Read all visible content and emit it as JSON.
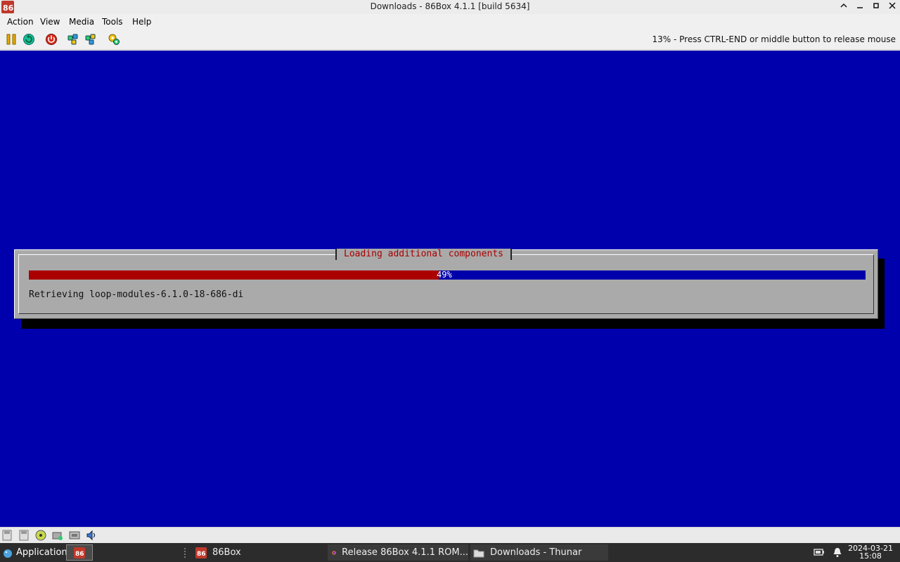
{
  "window": {
    "title": "Downloads - 86Box 4.1.1 [build 5634]",
    "controls": {
      "up": "⌃",
      "minimize": "_",
      "maximize": "▫",
      "close": "✕"
    }
  },
  "menu": [
    "Action",
    "View",
    "Media",
    "Tools",
    "Help"
  ],
  "toolbar": {
    "icons": [
      "pause-icon",
      "reset-icon",
      "power-icon",
      "ctrl-alt-del-icon",
      "ctrl-alt-esc-icon",
      "settings-icon"
    ],
    "status_text": "13% - Press CTRL-END or middle button to release mouse"
  },
  "screen": {
    "bg_color": "#0000ac",
    "dialog": {
      "title": "Loading additional components",
      "progress_percent": 49,
      "progress_label": "49%",
      "message": "Retrieving loop-modules-6.1.0-18-686-di"
    }
  },
  "statusbar": {
    "icons": [
      "floppy-drive-1-icon",
      "floppy-drive-2-icon",
      "cdrom-icon",
      "hard-disk-icon",
      "network-icon",
      "sound-icon"
    ]
  },
  "taskbar": {
    "applications_label": "Applications",
    "tasks": [
      {
        "label": "86Box",
        "icon": "86box-icon"
      },
      {
        "label": "Release 86Box 4.1.1 ROM...",
        "icon": "firefox-icon"
      },
      {
        "label": "Downloads - Thunar",
        "icon": "folder-icon"
      }
    ],
    "clock": {
      "date": "2024-03-21",
      "time": "15:08"
    }
  }
}
